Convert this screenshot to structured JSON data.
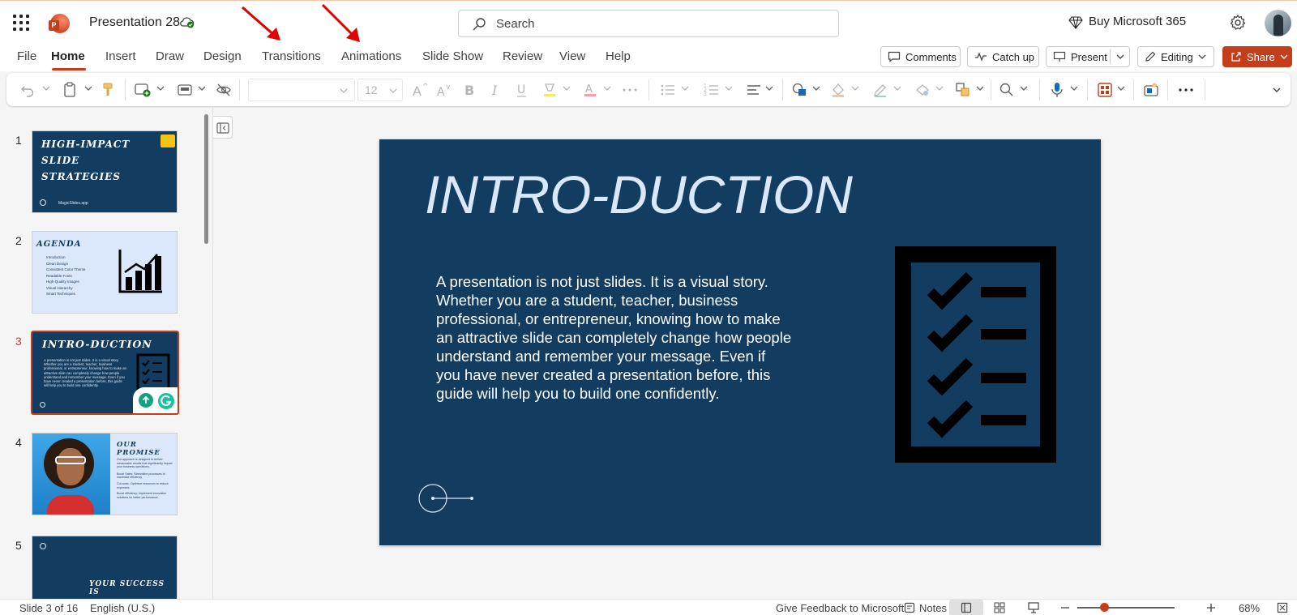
{
  "app": {
    "title": "Presentation 28",
    "search_placeholder": "Search",
    "buy_label": "Buy Microsoft 365"
  },
  "menu": {
    "tabs": [
      "File",
      "Home",
      "Insert",
      "Draw",
      "Design",
      "Transitions",
      "Animations",
      "Slide Show",
      "Review",
      "View",
      "Help"
    ],
    "active": "Home",
    "comments_label": "Comments",
    "catchup_label": "Catch up",
    "present_label": "Present",
    "editing_label": "Editing",
    "share_label": "Share"
  },
  "ribbon": {
    "font_size": "12"
  },
  "thumbnails": [
    {
      "number": "1",
      "title_lines": [
        "HIGH-IMPACT",
        "SLIDE",
        "STRATEGIES"
      ],
      "footer": "MagicSlides.app"
    },
    {
      "number": "2",
      "title": "AGENDA",
      "items": [
        "Introduction",
        "Clean Design",
        "Consistent Color Theme",
        "Readable Fonts",
        "High-Quality Images",
        "Visual Hierarchy",
        "Smart Techniques"
      ]
    },
    {
      "number": "3",
      "title": "INTRO-DUCTION",
      "text": "A presentation is not just slides. It is a visual story. Whether you are a student, teacher, business professional, or entrepreneur, knowing how to make an attractive slide can completely change how people understand and remember your message. Even if you have never created a presentation before, this guide will help you to build one confidently."
    },
    {
      "number": "4",
      "title_lines": [
        "OUR",
        "PROMISE"
      ],
      "intro": "Our approach is designed to deliver measurable results that significantly impact your business operations.",
      "bullets": [
        "Boost Sales: Streamline processes to maximize efficiency.",
        "Cut costs: Optimize resources to reduce expenses.",
        "Boost efficiency: Implement innovative solutions for better performance."
      ]
    },
    {
      "number": "5",
      "title": "YOUR SUCCESS IS"
    }
  ],
  "slide": {
    "title": "INTRO-DUCTION",
    "body": "A presentation is not just slides. It is a visual story. Whether you are a student, teacher, business professional, or entrepreneur, knowing how to make an attractive slide can completely change how people understand and remember your message. Even if you have never created a presentation before, this guide will help you to build one confidently."
  },
  "status": {
    "slide_counter": "Slide 3 of 16",
    "language": "English (U.S.)",
    "feedback_label": "Give Feedback to Microsoft",
    "notes_label": "Notes",
    "zoom": "68%"
  },
  "colors": {
    "accent": "#c43e1c",
    "slide_bg": "#123c60",
    "slide_title": "#dbe8fb",
    "annotation_arrow": "#e00000"
  }
}
